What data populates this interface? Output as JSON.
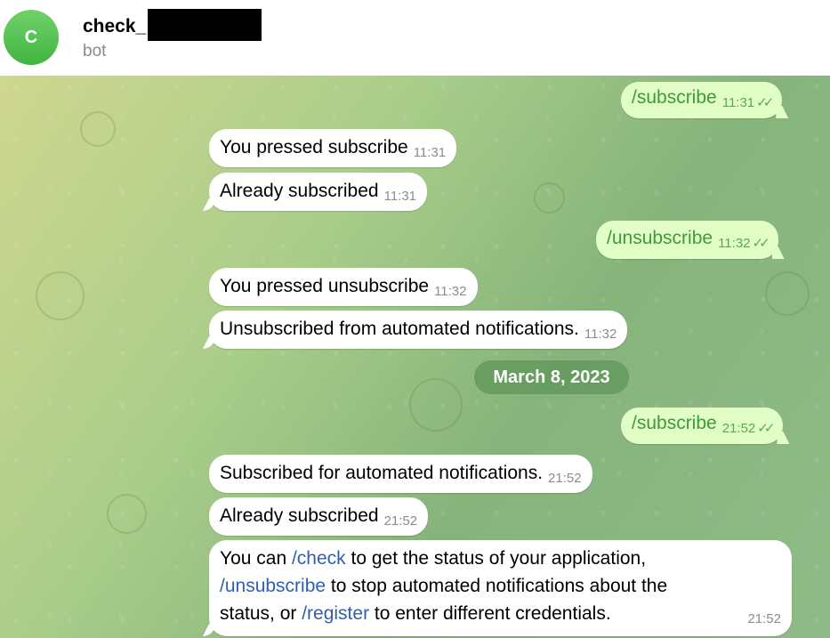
{
  "header": {
    "avatar_letter": "C",
    "title": "check_",
    "subtitle": "bot"
  },
  "messages": {
    "m1": {
      "text": "/subscribe",
      "time": "11:31"
    },
    "m2": {
      "text": "You pressed subscribe",
      "time": "11:31"
    },
    "m3": {
      "text": "Already subscribed",
      "time": "11:31"
    },
    "m4": {
      "text": "/unsubscribe",
      "time": "11:32"
    },
    "m5": {
      "text": "You pressed unsubscribe",
      "time": "11:32"
    },
    "m6": {
      "text": "Unsubscribed from automated notifications.",
      "time": "11:32"
    },
    "date": "March 8, 2023",
    "m7": {
      "text": "/subscribe",
      "time": "21:52"
    },
    "m8": {
      "text": "Subscribed for automated notifications.",
      "time": "21:52"
    },
    "m9": {
      "text": "Already subscribed",
      "time": "21:52"
    },
    "m10": {
      "p1": "You can ",
      "c1": "/check",
      "p2": " to get the status of your application,",
      "c2": "/unsubscribe",
      "p3": " to stop automated notifications about the status, or ",
      "c3": "/register",
      "p4": " to enter different credentials.",
      "time": "21:52"
    }
  },
  "ticks": "✓✓",
  "colors": {
    "outgoing_bg": "#e1fec6",
    "incoming_bg": "#ffffff",
    "command_link": "#2f5fb3",
    "accent_green": "#3e9a3a"
  }
}
